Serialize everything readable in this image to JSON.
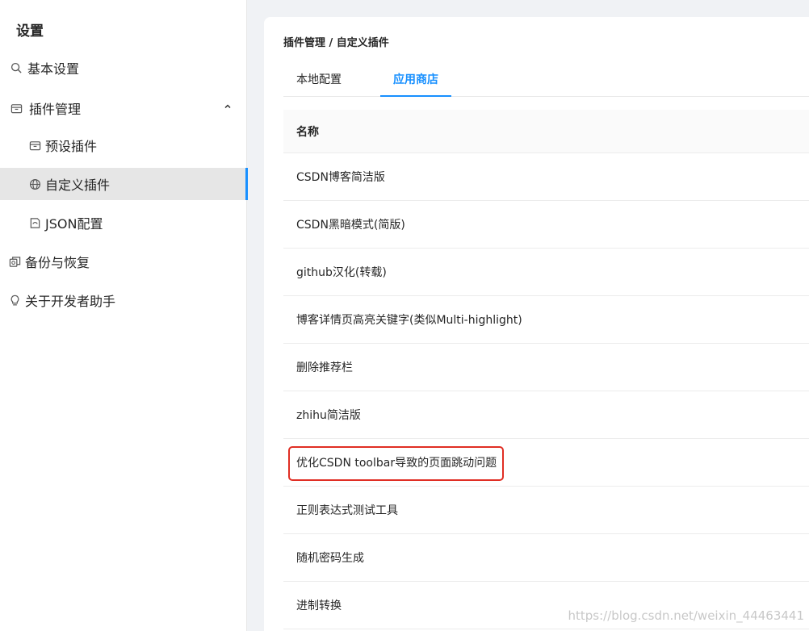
{
  "sidebar": {
    "title": "设置",
    "items": [
      {
        "label": "基本设置",
        "icon": "search-icon"
      },
      {
        "label": "插件管理",
        "icon": "box-icon",
        "expanded": true
      },
      {
        "label": "预设插件",
        "icon": "box-icon",
        "sub": true
      },
      {
        "label": "自定义插件",
        "icon": "globe-icon",
        "sub": true,
        "selected": true
      },
      {
        "label": "JSON配置",
        "icon": "file-icon",
        "sub": true
      },
      {
        "label": "备份与恢复",
        "icon": "copy-icon"
      },
      {
        "label": "关于开发者助手",
        "icon": "bulb-icon"
      }
    ],
    "accent_color": "#1890ff"
  },
  "main": {
    "breadcrumb": "插件管理 / 自定义插件",
    "tabs": [
      {
        "label": "本地配置",
        "active": false
      },
      {
        "label": "应用商店",
        "active": true
      }
    ],
    "table": {
      "header": "名称",
      "rows": [
        "CSDN博客简洁版",
        "CSDN黑暗模式(简版)",
        "github汉化(转载)",
        "博客详情页高亮关键字(类似Multi-highlight)",
        "删除推荐栏",
        "zhihu简洁版",
        "优化CSDN toolbar导致的页面跳动问题",
        "正则表达式测试工具",
        "随机密码生成",
        "进制转换"
      ],
      "highlighted_row": 6,
      "highlight_color": "#e02e24"
    }
  },
  "watermark": "https://blog.csdn.net/weixin_44463441"
}
